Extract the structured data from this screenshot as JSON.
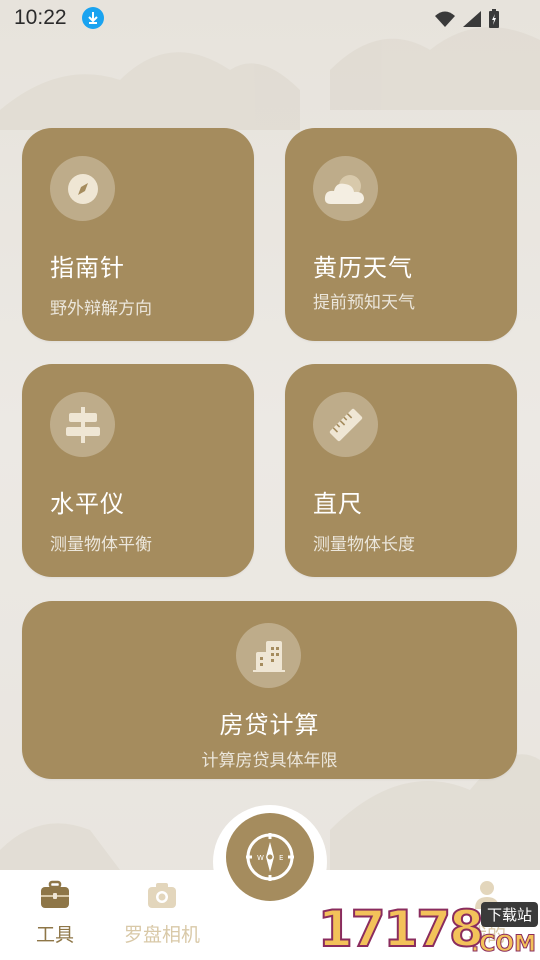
{
  "status_bar": {
    "time": "10:22"
  },
  "cards": {
    "compass": {
      "title": "指南针",
      "subtitle": "野外辩解方向"
    },
    "almanac": {
      "title": "黄历天气",
      "subtitle": "提前预知天气"
    },
    "level": {
      "title": "水平仪",
      "subtitle": "测量物体平衡"
    },
    "ruler": {
      "title": "直尺",
      "subtitle": "测量物体长度"
    },
    "mortgage": {
      "title": "房贷计算",
      "subtitle": "计算房贷具体年限"
    }
  },
  "bottom_nav": {
    "tools": {
      "label": "工具"
    },
    "camera": {
      "label": "罗盘相机"
    },
    "mine": {
      "label": "我的"
    }
  },
  "watermark": {
    "digits": "17178",
    "tag": "下载站",
    "suffix": ".COM"
  },
  "colors": {
    "card": "#a58c5e",
    "active_label": "#8e7647",
    "inactive_label": "#d9c9a8"
  }
}
